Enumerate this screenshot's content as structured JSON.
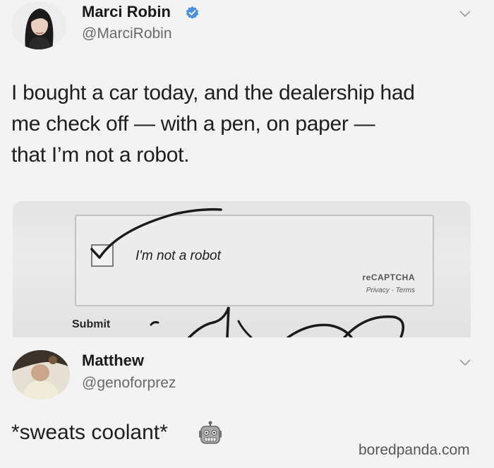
{
  "tweet": {
    "author_name": "Marci Robin",
    "handle": "@MarciRobin",
    "verified_icon": "verified-badge-icon",
    "text_lines": [
      "I bought a car today, and the dealership had",
      "me check off — with a pen, on paper —",
      "that I’m not a robot."
    ],
    "menu_icon": "chevron-down-icon"
  },
  "photo": {
    "checkbox_label": "I'm not a robot",
    "recaptcha_brand": "reCAPTCHA",
    "recaptcha_links": "Privacy - Terms",
    "submit_label": "Submit"
  },
  "reply": {
    "author_name": "Matthew",
    "handle": "@genoforprez",
    "text": "*sweats coolant*",
    "emoji_icon": "robot-face-icon",
    "menu_icon": "chevron-down-icon"
  },
  "watermark": "boredpanda.com",
  "colors": {
    "verified_blue": "#4a90e2",
    "background": "#f3f3f3",
    "handle_gray": "#6a6a6a"
  }
}
